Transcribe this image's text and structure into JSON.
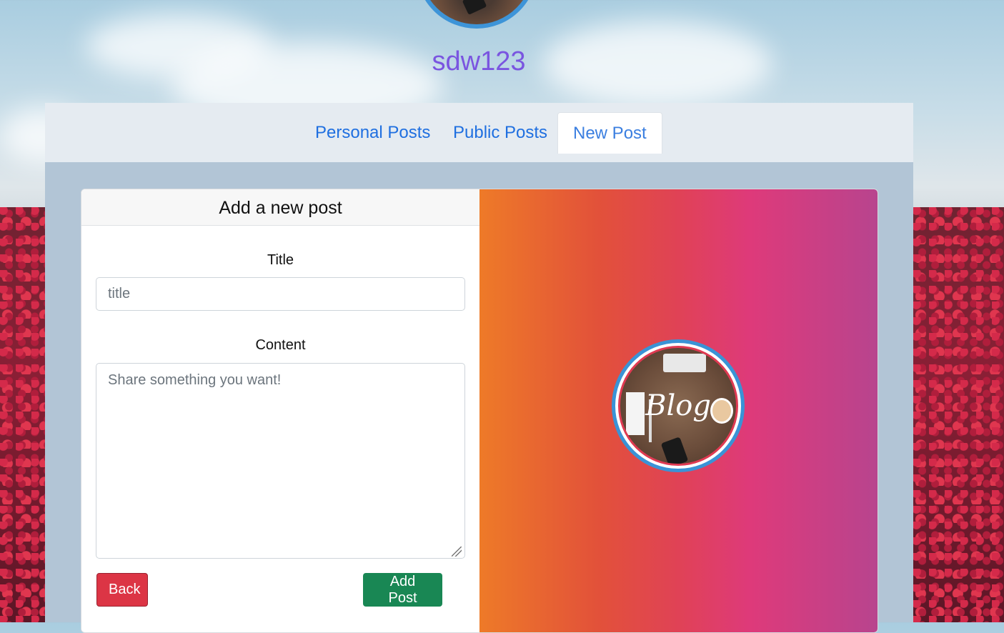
{
  "profile": {
    "username": "sdw123"
  },
  "nav": {
    "tabs": [
      {
        "label": "Personal Posts"
      },
      {
        "label": "Public Posts"
      },
      {
        "label": "New Post",
        "active": true
      }
    ]
  },
  "form": {
    "header": "Add a new post",
    "title_label": "Title",
    "title_placeholder": "title",
    "content_label": "Content",
    "content_placeholder": "Share something you want!",
    "back_label": "Back",
    "submit_label": "Add Post"
  },
  "logo": {
    "text": "Blog"
  },
  "colors": {
    "accent": "#1f6fe0",
    "username": "#7a55e0",
    "back_button": "#dc3545",
    "add_button": "#198754",
    "avatar_ring": "#3d94d8"
  }
}
